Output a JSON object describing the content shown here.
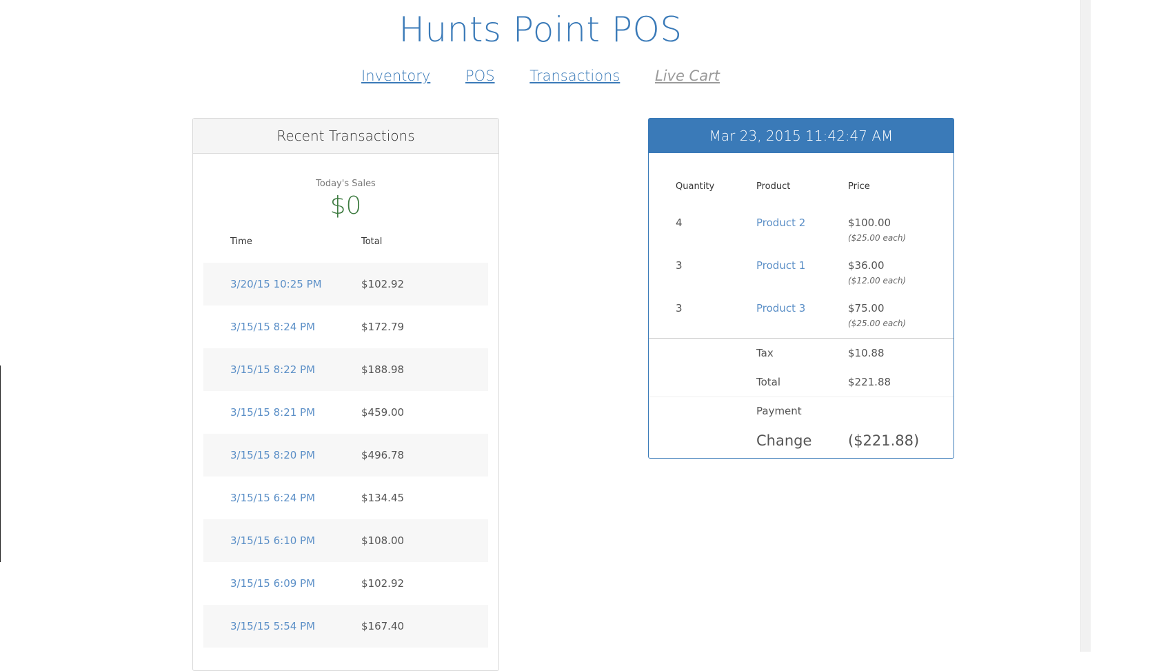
{
  "header": {
    "title": "Hunts Point POS",
    "nav": [
      "Inventory",
      "POS",
      "Transactions",
      "Live Cart"
    ]
  },
  "recent": {
    "title": "Recent Transactions",
    "sales_label": "Today's Sales",
    "sales_value": "$0",
    "col_time": "Time",
    "col_total": "Total",
    "rows": [
      {
        "time": "3/20/15 10:25 PM",
        "total": "$102.92"
      },
      {
        "time": "3/15/15 8:24 PM",
        "total": "$172.79"
      },
      {
        "time": "3/15/15 8:22 PM",
        "total": "$188.98"
      },
      {
        "time": "3/15/15 8:21 PM",
        "total": "$459.00"
      },
      {
        "time": "3/15/15 8:20 PM",
        "total": "$496.78"
      },
      {
        "time": "3/15/15 6:24 PM",
        "total": "$134.45"
      },
      {
        "time": "3/15/15 6:10 PM",
        "total": "$108.00"
      },
      {
        "time": "3/15/15 6:09 PM",
        "total": "$102.92"
      },
      {
        "time": "3/15/15 5:54 PM",
        "total": "$167.40"
      }
    ]
  },
  "cart": {
    "datetime": "Mar 23, 2015 11:42:47 AM",
    "col_quantity": "Quantity",
    "col_product": "Product",
    "col_price": "Price",
    "items": [
      {
        "qty": "4",
        "product": "Product 2",
        "price": "$100.00",
        "each": "($25.00 each)"
      },
      {
        "qty": "3",
        "product": "Product 1",
        "price": "$36.00",
        "each": "($12.00 each)"
      },
      {
        "qty": "3",
        "product": "Product 3",
        "price": "$75.00",
        "each": "($25.00 each)"
      }
    ],
    "tax_label": "Tax",
    "tax_value": "$10.88",
    "total_label": "Total",
    "total_value": "$221.88",
    "payment_label": "Payment",
    "change_label": "Change",
    "change_value": "($221.88)"
  },
  "colors": {
    "primary": "#3a7ab8",
    "sales_green": "#3c7a3f",
    "link": "#5b8fc7"
  }
}
